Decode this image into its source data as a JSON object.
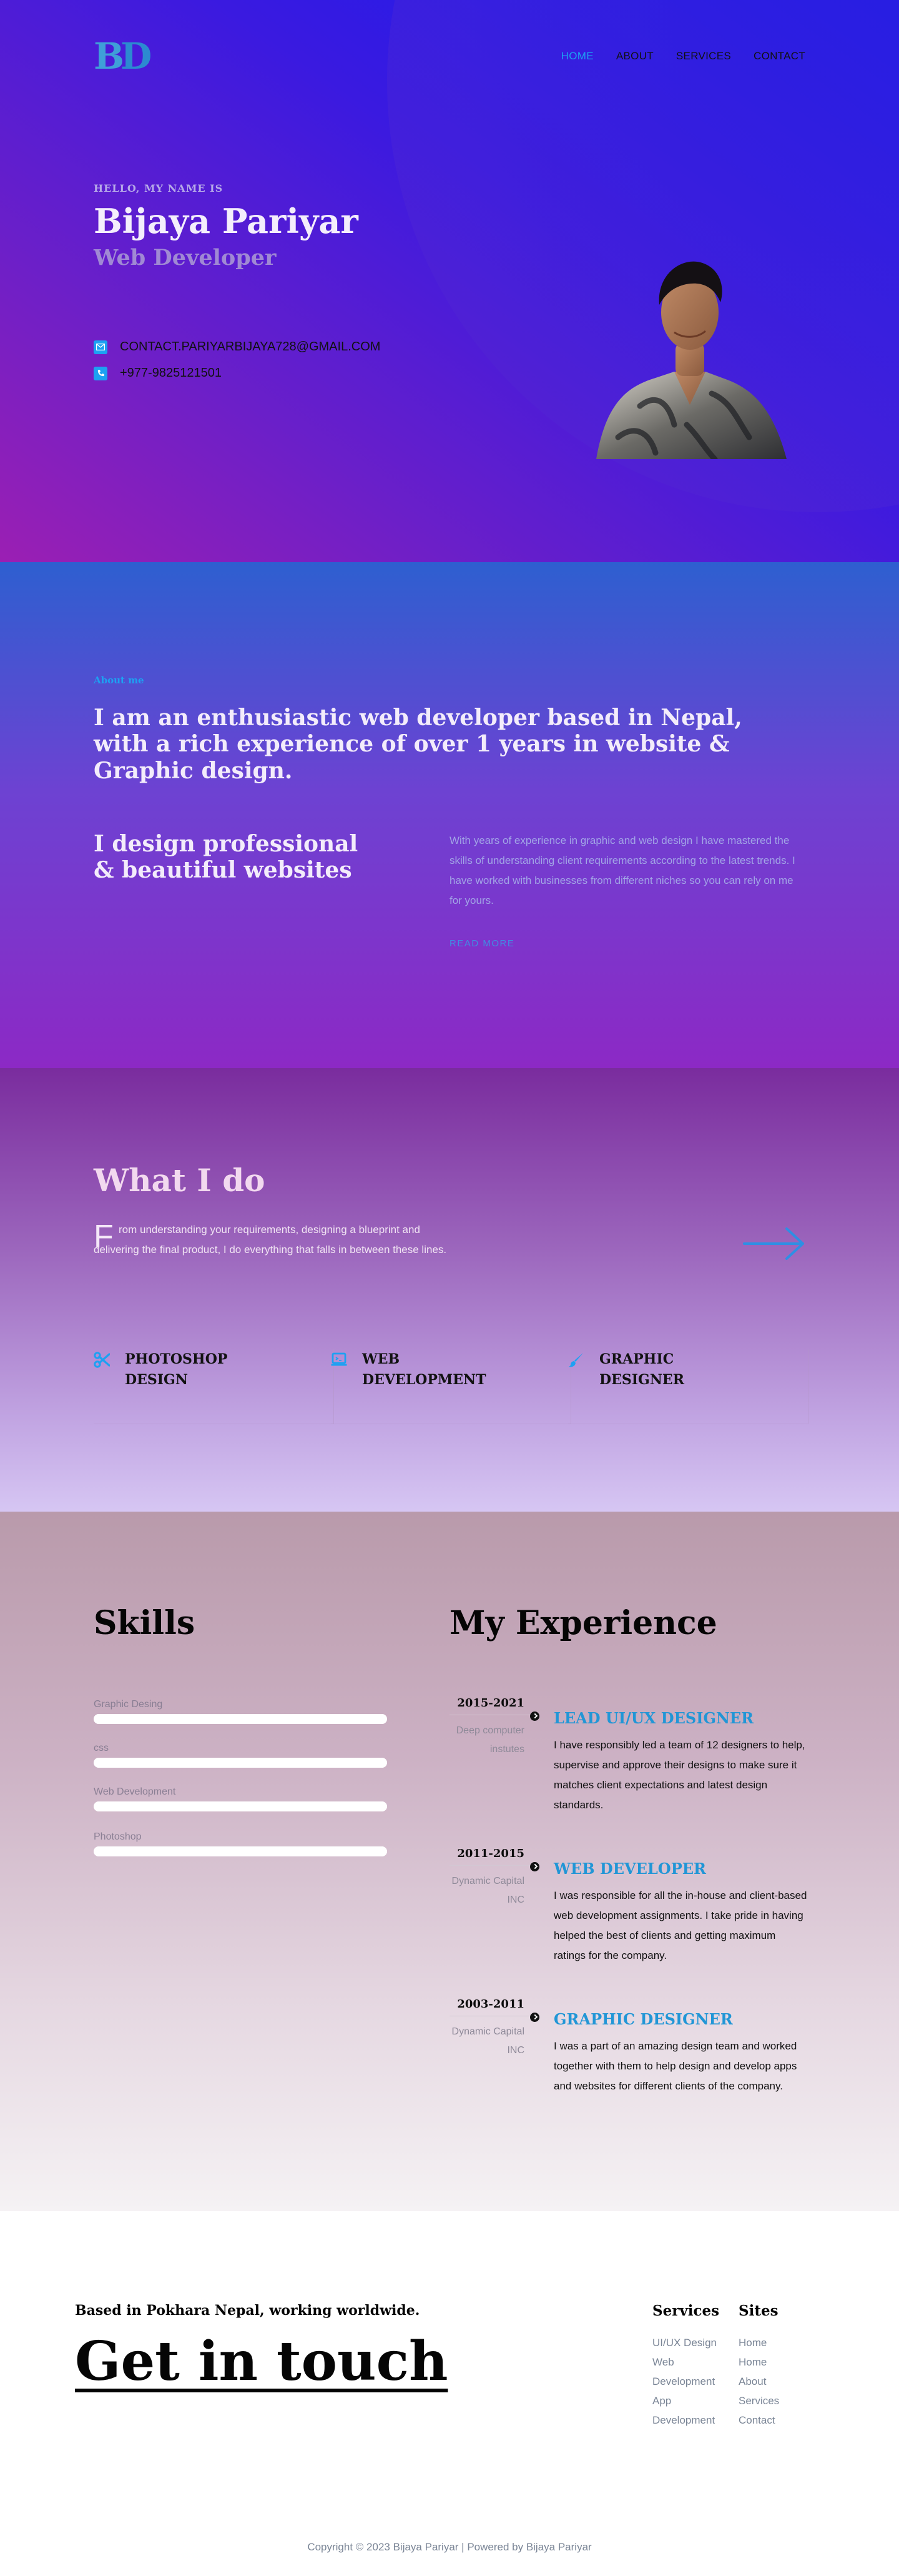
{
  "brand": {
    "logo_left": "B",
    "logo_right": "D"
  },
  "nav": {
    "items": [
      "HOME",
      "ABOUT",
      "SERVICES",
      "CONTACT"
    ]
  },
  "hero": {
    "greeting": "HELLO, MY NAME IS",
    "name": "Bijaya Pariyar",
    "role": "Web Developer",
    "email": "CONTACT.PARIYARBIJAYA728@GMAIL.COM",
    "phone": "+977-9825121501"
  },
  "about": {
    "kicker": "About me",
    "lead": "I am an enthusiastic web developer based in Nepal, with a rich experience of over 1 years in website & Graphic design.",
    "subheading": "I design professional & beautiful websites",
    "paragraph": "With years of experience in graphic and web design I have mastered the skills of understanding client requirements according to the latest trends. I have worked with businesses from different niches so you can rely on me for yours.",
    "read_more": "READ MORE"
  },
  "services": {
    "title": "What I do",
    "dropcap": "F",
    "description": "rom understanding your requirements, designing a blueprint and delivering the final product, I do everything that falls in between these lines.",
    "cards": [
      {
        "title": "PHOTOSHOP DESIGN",
        "icon": "scissors-icon"
      },
      {
        "title": "WEB DEVELOPMENT",
        "icon": "laptop-icon"
      },
      {
        "title": "GRAPHIC DESIGNER",
        "icon": "brush-icon"
      }
    ]
  },
  "skills": {
    "title": "Skills",
    "items": [
      {
        "label": "Graphic Desing",
        "level": 1.0
      },
      {
        "label": "css",
        "level": 1.0
      },
      {
        "label": "Web Development",
        "level": 1.0
      },
      {
        "label": "Photoshop",
        "level": 1.0
      }
    ]
  },
  "experience": {
    "title": "My Experience",
    "items": [
      {
        "years": "2015-2021",
        "company": "Deep computer instutes",
        "role": "LEAD UI/UX DESIGNER",
        "description": "I have responsibly led a team of 12 designers to help, supervise and approve their designs to make sure it matches client expectations and latest design standards."
      },
      {
        "years": "2011-2015",
        "company": "Dynamic Capital INC",
        "role": "WEB DEVELOPER",
        "description": "I was responsible for all the in-house and client-based web development assignments. I take pride in having helped the best of clients and getting maximum ratings for the company."
      },
      {
        "years": "2003-2011",
        "company": "Dynamic Capital INC",
        "role": "GRAPHIC DESIGNER",
        "description": "I was a part of an amazing design team and worked together with them to help design and develop apps and websites for different clients of the company."
      }
    ]
  },
  "footer": {
    "based": "Based in Pokhara Nepal, working worldwide.",
    "cta": "Get in touch",
    "services_title": "Services",
    "services_links": [
      "UI/UX Design",
      "Web Development",
      "App Development"
    ],
    "sites_title": "Sites",
    "sites_links": [
      "Home",
      "Home",
      "About",
      "Services",
      "Contact"
    ],
    "copyright": "Copyright © 2023 Bijaya Pariyar | Powered by Bijaya Pariyar"
  },
  "colors": {
    "accent": "#1da1f2",
    "role_blue": "#2196d6",
    "dark": "#050505"
  }
}
